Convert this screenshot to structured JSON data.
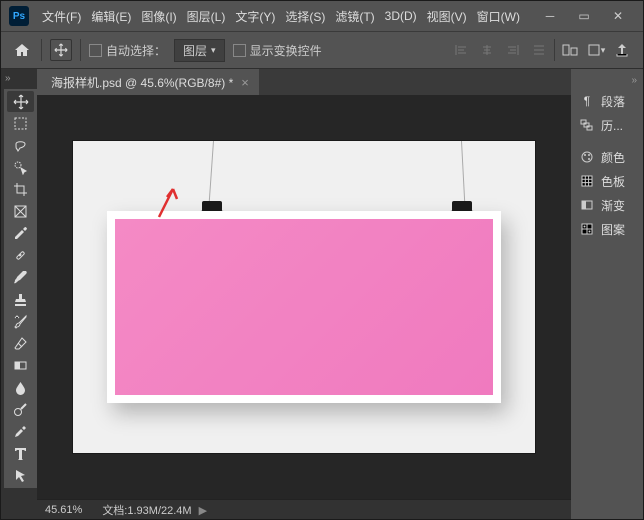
{
  "menu": [
    "文件(F)",
    "编辑(E)",
    "图像(I)",
    "图层(L)",
    "文字(Y)",
    "选择(S)",
    "滤镜(T)",
    "3D(D)",
    "视图(V)",
    "窗口(W)"
  ],
  "options": {
    "auto_select_label": "自动选择：",
    "dropdown_value": "图层",
    "show_transform_label": "显示变换控件"
  },
  "doc": {
    "tab_title": "海报样机.psd @ 45.6%(RGB/8#) *"
  },
  "status": {
    "zoom": "45.61%",
    "doc_label": "文档:",
    "doc_size": "1.93M/22.4M"
  },
  "panels": [
    "段落",
    "历...",
    "颜色",
    "色板",
    "渐变",
    "图案"
  ]
}
